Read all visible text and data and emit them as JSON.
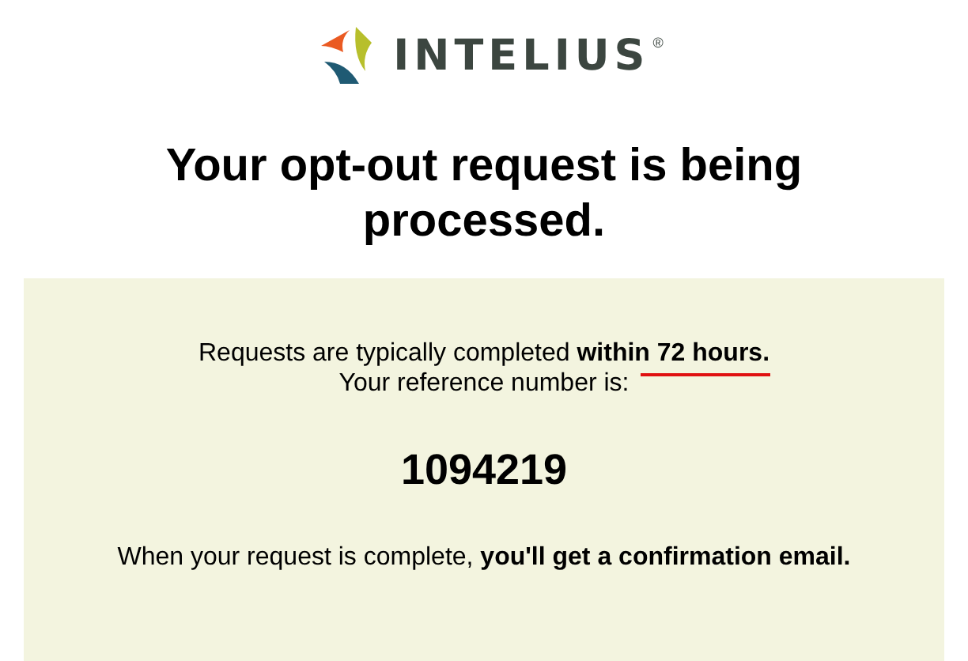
{
  "logo": {
    "wordmark": "INTELIUS",
    "registered": "®"
  },
  "heading": "Your opt-out request is being processed.",
  "panel": {
    "timing": "Requests are typically completed **within 72 hours.**",
    "timing_underlined": true,
    "reference_label": "Your reference number is:",
    "reference_number": "1094219",
    "confirmation": "When your request is complete, **you'll get a confirmation email.**"
  }
}
